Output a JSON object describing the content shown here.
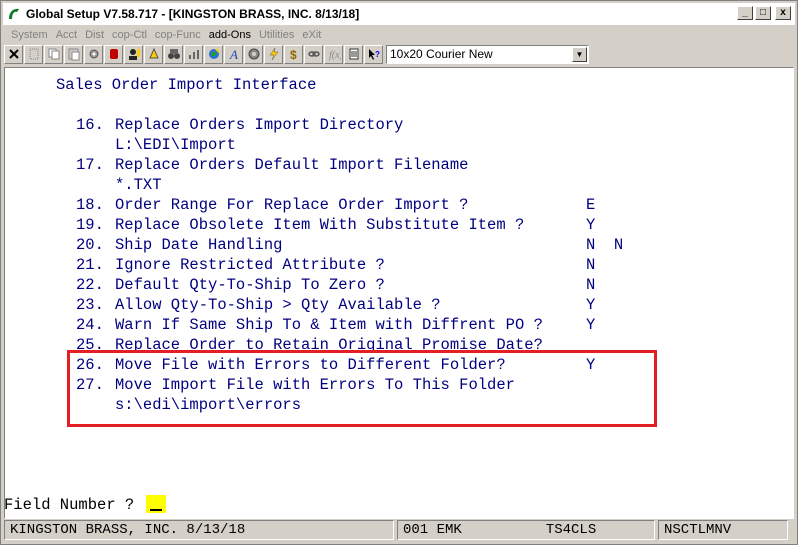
{
  "window": {
    "title": "Global Setup V7.58.717 - [KINGSTON BRASS, INC. 8/13/18]",
    "min": "_",
    "max": "□",
    "close": "x"
  },
  "menu": [
    "System",
    "Acct",
    "Dist",
    "cop-Ctl",
    "cop-Func",
    "add-Ons",
    "Utilities",
    "eXit"
  ],
  "toolbar": {
    "icons": [
      "close-icon",
      "blank-icon",
      "copy-icon",
      "paste-icon",
      "settings-icon",
      "stop-icon",
      "user-icon",
      "bell-icon",
      "binoculars-icon",
      "chart-icon",
      "globe-icon",
      "font-icon",
      "gear-icon",
      "lightning-icon",
      "dollar-icon",
      "link-icon",
      "function-icon",
      "list-icon",
      "help-pointer-icon"
    ],
    "font_select": "10x20 Courier New"
  },
  "screen": {
    "heading": "Sales Order Import Interface",
    "lines": [
      {
        "num": "16.",
        "label": "Replace Orders Import Directory",
        "value": ""
      },
      {
        "num": "",
        "label": "L:\\EDI\\Import",
        "value": ""
      },
      {
        "num": "17.",
        "label": "Replace Orders Default Import Filename",
        "value": ""
      },
      {
        "num": "",
        "label": "*.TXT",
        "value": ""
      },
      {
        "num": "18.",
        "label": "Order Range For Replace Order Import ?",
        "value": "E"
      },
      {
        "num": "19.",
        "label": "Replace Obsolete Item With Substitute Item ?",
        "value": "Y"
      },
      {
        "num": "20.",
        "label": "Ship Date Handling",
        "value": "N  N"
      },
      {
        "num": "21.",
        "label": "Ignore Restricted Attribute ?",
        "value": "N"
      },
      {
        "num": "22.",
        "label": "Default Qty-To-Ship To Zero ?",
        "value": "N"
      },
      {
        "num": "23.",
        "label": "Allow Qty-To-Ship > Qty Available ?",
        "value": "Y"
      },
      {
        "num": "24.",
        "label": "Warn If Same Ship To & Item with Diffrent PO ?",
        "value": "Y"
      },
      {
        "num": "25.",
        "label": "Replace Order to Retain Original Promise Date?",
        "value": ""
      },
      {
        "num": "26.",
        "label": "Move File with Errors to Different Folder?",
        "value": "Y"
      },
      {
        "num": "27.",
        "label": "Move Import File with Errors To This Folder",
        "value": ""
      },
      {
        "num": "",
        "label": "s:\\edi\\import\\errors",
        "value": ""
      }
    ],
    "prompt": "Field Number ?"
  },
  "status": {
    "company": "KINGSTON BRASS, INC. 8/13/18",
    "user": "001 EMK",
    "terminal": "TS4CLS",
    "program": "NSCTLMNV"
  },
  "colors": {
    "terminal_text": "#000080",
    "highlight_border": "#e31e24",
    "cursor": "#ffff00"
  }
}
